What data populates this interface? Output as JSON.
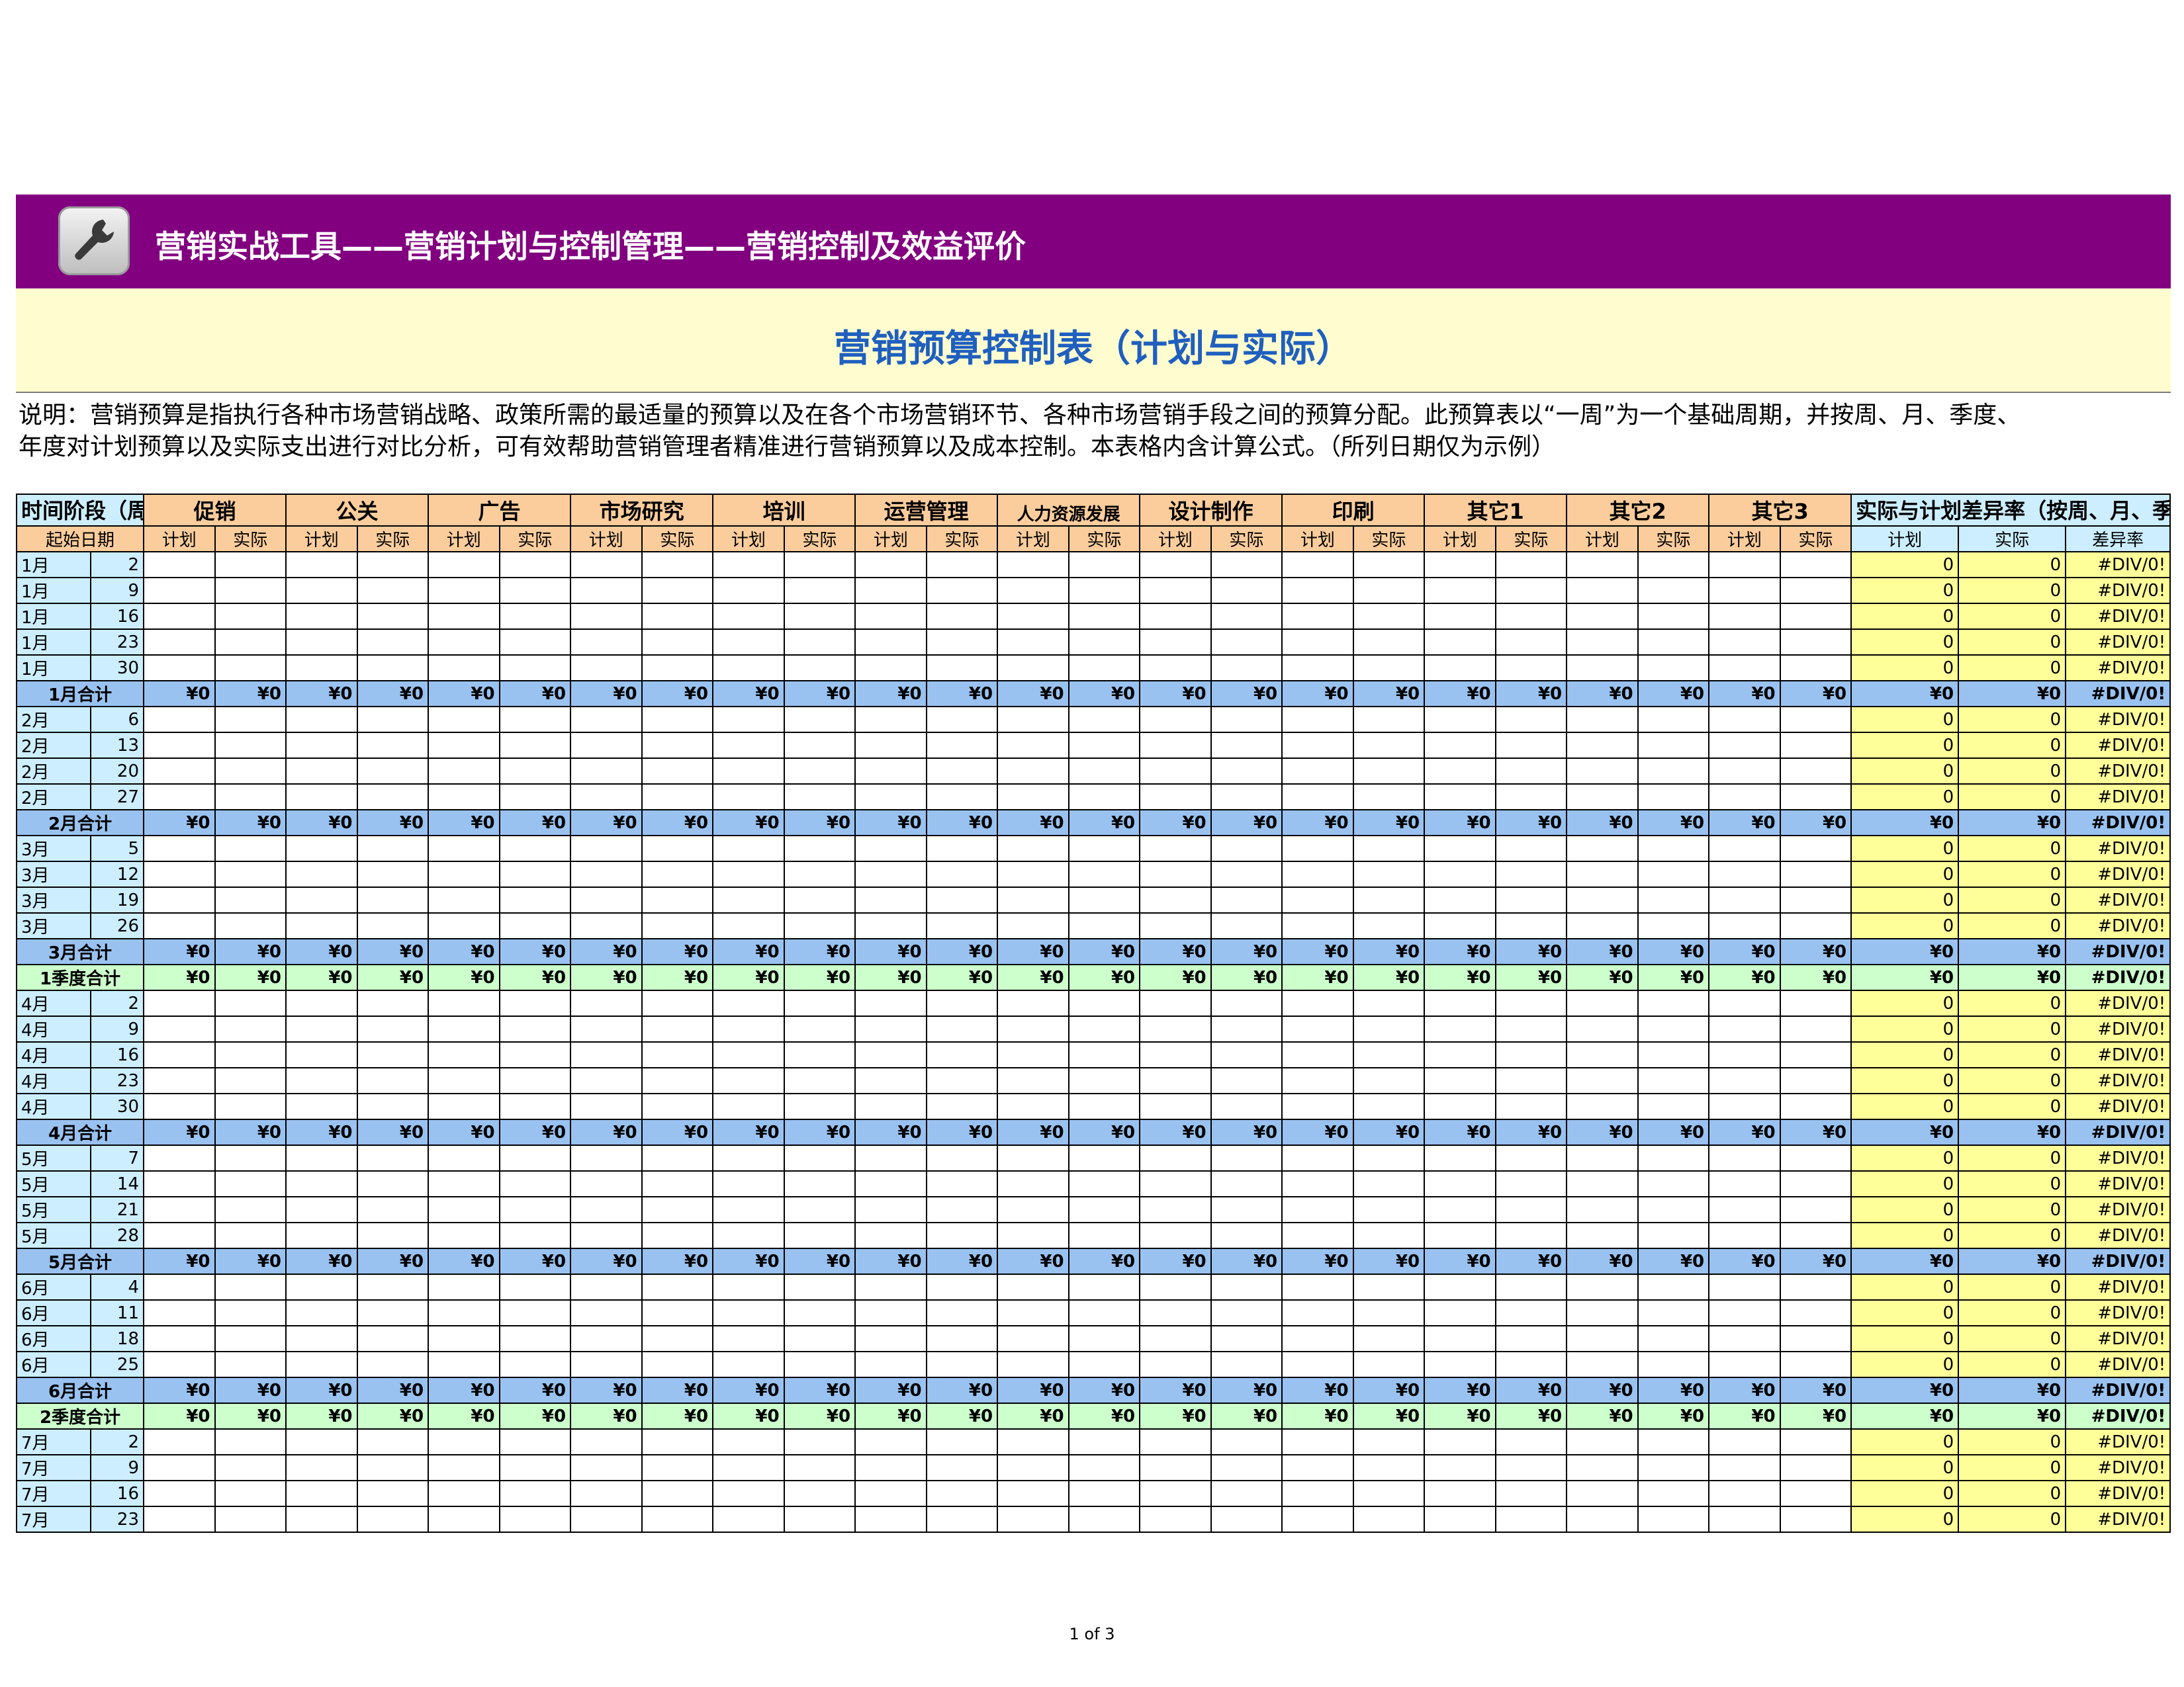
{
  "header": {
    "title": "营销实战工具——营销计划与控制管理——营销控制及效益评价",
    "icon": "wrench-icon"
  },
  "main_title": "营销预算控制表（计划与实际）",
  "description": [
    "说明：营销预算是指执行各种市场营销战略、政策所需的最适量的预算以及在各个市场营销环节、各种市场营销手段之间的预算分配。此预算表以“一周”为一个基础周期，并按周、月、季度、",
    "年度对计划预算以及实际支出进行对比分析，可有效帮助营销管理者精准进行营销预算以及成本控制。本表格内含计算公式。（所列日期仅为示例）"
  ],
  "table": {
    "period_header": "时间阶段（周一）",
    "categories": [
      "促销",
      "公关",
      "广告",
      "市场研究",
      "培训",
      "运营管理",
      "人力资源发展",
      "设计制作",
      "印刷",
      "其它1",
      "其它2",
      "其它3"
    ],
    "variance_header": "实际与计划差异率（按周、月、季度、年度）",
    "start_date_label": "起始日期",
    "plan_label": "计划",
    "actual_label": "实际",
    "variance_rate_label": "差异率",
    "rows": [
      {
        "type": "week",
        "month": "1月",
        "day": "2",
        "plan": "0",
        "actual": "0",
        "rate": "#DIV/0!"
      },
      {
        "type": "week",
        "month": "1月",
        "day": "9",
        "plan": "0",
        "actual": "0",
        "rate": "#DIV/0!"
      },
      {
        "type": "week",
        "month": "1月",
        "day": "16",
        "plan": "0",
        "actual": "0",
        "rate": "#DIV/0!"
      },
      {
        "type": "week",
        "month": "1月",
        "day": "23",
        "plan": "0",
        "actual": "0",
        "rate": "#DIV/0!"
      },
      {
        "type": "week",
        "month": "1月",
        "day": "30",
        "plan": "0",
        "actual": "0",
        "rate": "#DIV/0!"
      },
      {
        "type": "month",
        "label": "1月合计",
        "value": "¥0",
        "plan": "¥0",
        "actual": "¥0",
        "rate": "#DIV/0!"
      },
      {
        "type": "week",
        "month": "2月",
        "day": "6",
        "plan": "0",
        "actual": "0",
        "rate": "#DIV/0!"
      },
      {
        "type": "week",
        "month": "2月",
        "day": "13",
        "plan": "0",
        "actual": "0",
        "rate": "#DIV/0!"
      },
      {
        "type": "week",
        "month": "2月",
        "day": "20",
        "plan": "0",
        "actual": "0",
        "rate": "#DIV/0!"
      },
      {
        "type": "week",
        "month": "2月",
        "day": "27",
        "plan": "0",
        "actual": "0",
        "rate": "#DIV/0!"
      },
      {
        "type": "month",
        "label": "2月合计",
        "value": "¥0",
        "plan": "¥0",
        "actual": "¥0",
        "rate": "#DIV/0!"
      },
      {
        "type": "week",
        "month": "3月",
        "day": "5",
        "plan": "0",
        "actual": "0",
        "rate": "#DIV/0!"
      },
      {
        "type": "week",
        "month": "3月",
        "day": "12",
        "plan": "0",
        "actual": "0",
        "rate": "#DIV/0!"
      },
      {
        "type": "week",
        "month": "3月",
        "day": "19",
        "plan": "0",
        "actual": "0",
        "rate": "#DIV/0!"
      },
      {
        "type": "week",
        "month": "3月",
        "day": "26",
        "plan": "0",
        "actual": "0",
        "rate": "#DIV/0!"
      },
      {
        "type": "month",
        "label": "3月合计",
        "value": "¥0",
        "plan": "¥0",
        "actual": "¥0",
        "rate": "#DIV/0!"
      },
      {
        "type": "quarter",
        "label": "1季度合计",
        "value": "¥0",
        "plan": "¥0",
        "actual": "¥0",
        "rate": "#DIV/0!"
      },
      {
        "type": "week",
        "month": "4月",
        "day": "2",
        "plan": "0",
        "actual": "0",
        "rate": "#DIV/0!"
      },
      {
        "type": "week",
        "month": "4月",
        "day": "9",
        "plan": "0",
        "actual": "0",
        "rate": "#DIV/0!"
      },
      {
        "type": "week",
        "month": "4月",
        "day": "16",
        "plan": "0",
        "actual": "0",
        "rate": "#DIV/0!"
      },
      {
        "type": "week",
        "month": "4月",
        "day": "23",
        "plan": "0",
        "actual": "0",
        "rate": "#DIV/0!"
      },
      {
        "type": "week",
        "month": "4月",
        "day": "30",
        "plan": "0",
        "actual": "0",
        "rate": "#DIV/0!"
      },
      {
        "type": "month",
        "label": "4月合计",
        "value": "¥0",
        "plan": "¥0",
        "actual": "¥0",
        "rate": "#DIV/0!"
      },
      {
        "type": "week",
        "month": "5月",
        "day": "7",
        "plan": "0",
        "actual": "0",
        "rate": "#DIV/0!"
      },
      {
        "type": "week",
        "month": "5月",
        "day": "14",
        "plan": "0",
        "actual": "0",
        "rate": "#DIV/0!"
      },
      {
        "type": "week",
        "month": "5月",
        "day": "21",
        "plan": "0",
        "actual": "0",
        "rate": "#DIV/0!"
      },
      {
        "type": "week",
        "month": "5月",
        "day": "28",
        "plan": "0",
        "actual": "0",
        "rate": "#DIV/0!"
      },
      {
        "type": "month",
        "label": "5月合计",
        "value": "¥0",
        "plan": "¥0",
        "actual": "¥0",
        "rate": "#DIV/0!"
      },
      {
        "type": "week",
        "month": "6月",
        "day": "4",
        "plan": "0",
        "actual": "0",
        "rate": "#DIV/0!"
      },
      {
        "type": "week",
        "month": "6月",
        "day": "11",
        "plan": "0",
        "actual": "0",
        "rate": "#DIV/0!"
      },
      {
        "type": "week",
        "month": "6月",
        "day": "18",
        "plan": "0",
        "actual": "0",
        "rate": "#DIV/0!"
      },
      {
        "type": "week",
        "month": "6月",
        "day": "25",
        "plan": "0",
        "actual": "0",
        "rate": "#DIV/0!"
      },
      {
        "type": "month",
        "label": "6月合计",
        "value": "¥0",
        "plan": "¥0",
        "actual": "¥0",
        "rate": "#DIV/0!"
      },
      {
        "type": "quarter",
        "label": "2季度合计",
        "value": "¥0",
        "plan": "¥0",
        "actual": "¥0",
        "rate": "#DIV/0!"
      },
      {
        "type": "week",
        "month": "7月",
        "day": "2",
        "plan": "0",
        "actual": "0",
        "rate": "#DIV/0!"
      },
      {
        "type": "week",
        "month": "7月",
        "day": "9",
        "plan": "0",
        "actual": "0",
        "rate": "#DIV/0!"
      },
      {
        "type": "week",
        "month": "7月",
        "day": "16",
        "plan": "0",
        "actual": "0",
        "rate": "#DIV/0!"
      },
      {
        "type": "week",
        "month": "7月",
        "day": "23",
        "plan": "0",
        "actual": "0",
        "rate": "#DIV/0!"
      }
    ]
  },
  "footer": {
    "page": "1 of 3"
  },
  "colors": {
    "header_bg": "#820080",
    "title_band_bg": "#fffdcf",
    "title_text": "#1f5fbf",
    "category_header_bg": "#fbcd9c",
    "period_bg": "#cceeff",
    "variance_bg": "#ffff99",
    "month_total_bg": "#99c2f0",
    "quarter_total_bg": "#ccffcc"
  }
}
